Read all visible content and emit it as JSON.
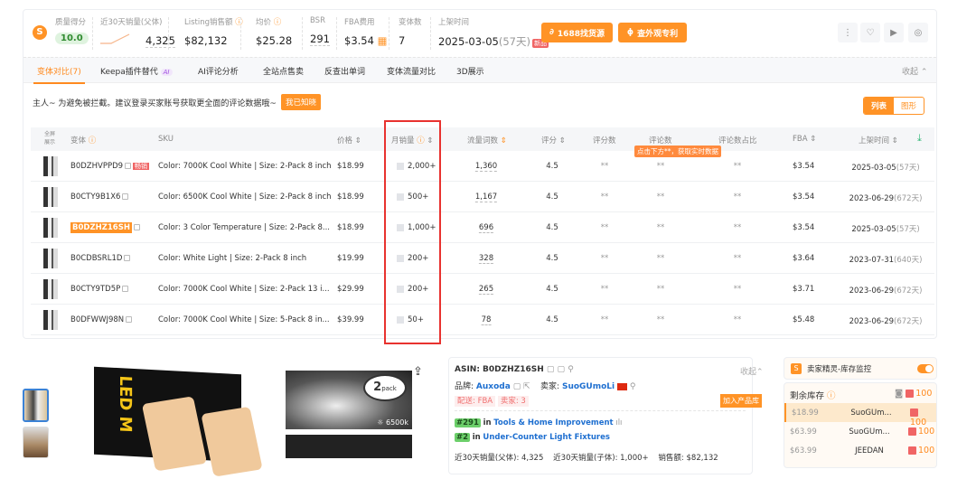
{
  "header": {
    "metrics": [
      {
        "label": "质量得分",
        "value": "10.0"
      },
      {
        "label": "近30天销量(父体)",
        "value": "4,325"
      },
      {
        "label": "Listing销售额",
        "value": "$82,132"
      },
      {
        "label": "均价",
        "value": "$25.28"
      },
      {
        "label": "BSR",
        "value": "291"
      },
      {
        "label": "FBA费用",
        "value": "$3.54"
      },
      {
        "label": "变体数",
        "value": "7"
      },
      {
        "label": "上架时间",
        "value": "2025-03-05",
        "days": "(57天)",
        "badge": "新品"
      }
    ],
    "btn_1688": "1688找货源",
    "btn_patent": "查外观专利"
  },
  "tabs": [
    "变体对比(7)",
    "Keepa插件替代",
    "AI评论分析",
    "全站点售卖",
    "反查出单词",
    "变体流量对比",
    "3D展示"
  ],
  "tab_ai_badge": "AI",
  "collapse": "收起",
  "notice": {
    "text": "主人~ 为避免被拦截。建议登录买家账号获取更全面的评论数据哦~",
    "button": "我已知晓"
  },
  "view_toggle": {
    "list": "列表",
    "graph": "图形"
  },
  "table": {
    "headers": {
      "fullscreen": "全屏展示",
      "variant": "变体",
      "sku": "SKU",
      "price": "价格",
      "monthly": "月销量",
      "traffic": "流量词数",
      "rating": "评分",
      "rating_count": "评分数",
      "reviews": "评论数",
      "review_ratio": "评论数占比",
      "fba": "FBA",
      "listed": "上架时间"
    },
    "tooltip": "点击下方**，获取实时数据",
    "rows": [
      {
        "asin": "B0DZHVPPD9",
        "tag": "畅销",
        "sku": "Color: 7000K Cool White | Size: 2-Pack 8 inch",
        "price": "$18.99",
        "monthly": "2,000+",
        "traffic": "1,360",
        "rating": "4.5",
        "rc": "**",
        "rv": "**",
        "rr": "**",
        "fba": "$3.54",
        "date": "2025-03-05",
        "days": "(57天)"
      },
      {
        "asin": "B0CTY9B1X6",
        "sku": "Color: 6500K Cool White | Size: 2-Pack 8 inch",
        "price": "$18.99",
        "monthly": "500+",
        "traffic": "1,167",
        "rating": "4.5",
        "rc": "**",
        "rv": "**",
        "rr": "**",
        "fba": "$3.54",
        "date": "2023-06-29",
        "days": "(672天)"
      },
      {
        "asin": "B0DZHZ16SH",
        "current": true,
        "sku": "Color: 3 Color Temperature | Size: 2-Pack 8...",
        "price": "$18.99",
        "monthly": "1,000+",
        "traffic": "696",
        "rating": "4.5",
        "rc": "**",
        "rv": "**",
        "rr": "**",
        "fba": "$3.54",
        "date": "2025-03-05",
        "days": "(57天)"
      },
      {
        "asin": "B0CDBSRL1D",
        "sku": "Color: White Light | Size: 2-Pack 8 inch",
        "price": "$19.99",
        "monthly": "200+",
        "traffic": "328",
        "rating": "4.5",
        "rc": "**",
        "rv": "**",
        "rr": "**",
        "fba": "$3.64",
        "date": "2023-07-31",
        "days": "(640天)"
      },
      {
        "asin": "B0CTY9TD5P",
        "sku": "Color: 7000K Cool White | Size: 2-Pack 13 i...",
        "price": "$29.99",
        "monthly": "200+",
        "traffic": "265",
        "rating": "4.5",
        "rc": "**",
        "rv": "**",
        "rr": "**",
        "fba": "$3.71",
        "date": "2023-06-29",
        "days": "(672天)"
      },
      {
        "asin": "B0DFWWJ98N",
        "sku": "Color: 7000K Cool White | Size: 5-Pack 8 in...",
        "price": "$39.99",
        "monthly": "50+",
        "traffic": "78",
        "rating": "4.5",
        "rc": "**",
        "rv": "**",
        "rr": "**",
        "fba": "$5.48",
        "date": "2023-06-29",
        "days": "(672天)"
      }
    ]
  },
  "product": {
    "image_text": {
      "pack": "2",
      "pack_label": "pack",
      "temp": "6500k",
      "box": "LED M"
    },
    "asin_label": "ASIN: B0DZHZ16SH",
    "collapse": "收起",
    "brand_label": "品牌:",
    "brand": "Auxoda",
    "seller_label": "卖家:",
    "seller": "SuoGUmoLi",
    "ship": "配送: FBA",
    "sellers": "卖家: 3",
    "add_btn": "加入产品库",
    "ranks": [
      {
        "rank": "#291",
        "in": "in",
        "cat": "Tools & Home Improvement"
      },
      {
        "rank": "#2",
        "in": "in",
        "cat": "Under-Counter Light Fixtures"
      }
    ],
    "bottom": "近30天销量(父体): 4,325    近30天销量(子体): 1,000+    销售额: $82,132"
  },
  "inventory": {
    "title": "卖家精灵-库存监控",
    "remaining": "剩余库存",
    "total": "100",
    "rows": [
      {
        "price": "$18.99",
        "seller": "SuoGUm...",
        "qty": "100"
      },
      {
        "price": "$63.99",
        "seller": "SuoGUm...",
        "qty": "100"
      },
      {
        "price": "$63.99",
        "seller": "JEEDAN",
        "qty": "100"
      }
    ]
  },
  "colors": {
    "accent": "#ff9326",
    "highlight": "#e8322f",
    "link": "#1e6fd0"
  }
}
